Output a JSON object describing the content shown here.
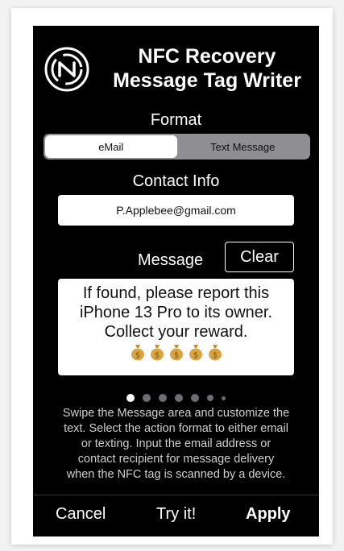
{
  "app": {
    "title_line1": "NFC Recovery",
    "title_line2": "Message Tag Writer"
  },
  "format": {
    "label": "Format",
    "options": [
      "eMail",
      "Text Message"
    ],
    "selected": "eMail"
  },
  "contact": {
    "label": "Contact Info",
    "value": "P.Applebee@gmail.com"
  },
  "message": {
    "label": "Message",
    "clear_label": "Clear",
    "lines": [
      "If found, please report this",
      "iPhone 13 Pro to its owner.",
      "Collect your reward."
    ],
    "emoji_count": 5,
    "emoji_icon": "money-bag-icon"
  },
  "page_indicator": {
    "pages": 7,
    "current": 1
  },
  "help": {
    "lines": [
      "Swipe the Message area and customize the",
      "text. Select the action format to either email",
      "or texting. Input the email address or",
      "contact recipient for message delivery",
      "when the NFC tag is scanned by a device."
    ]
  },
  "toolbar": {
    "cancel_label": "Cancel",
    "try_label": "Try it!",
    "apply_label": "Apply"
  },
  "colors": {
    "background": "#000000",
    "text": "#ffffff",
    "segment_track": "#8e8e93",
    "segment_active": "#ffffff",
    "money_bag": "#d9a441"
  }
}
